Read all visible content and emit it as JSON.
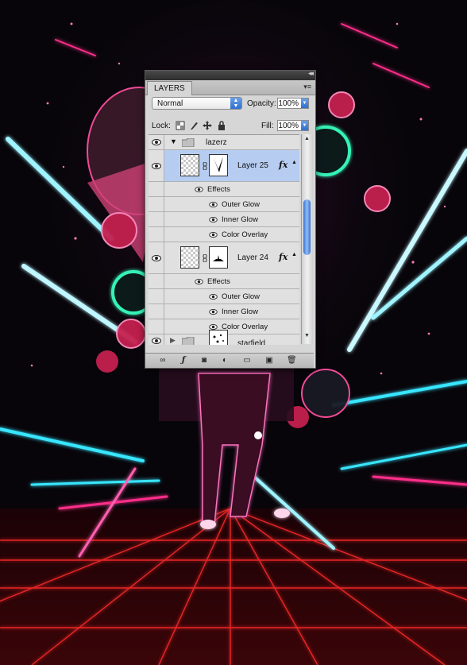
{
  "panel": {
    "tab_title": "LAYERS",
    "blend_mode": "Normal",
    "opacity_label": "Opacity:",
    "opacity_value": "100%",
    "lock_label": "Lock:",
    "fill_label": "Fill:",
    "fill_value": "100%"
  },
  "layers": {
    "group_name": "lazerz",
    "layer25": {
      "name": "Layer 25",
      "fx": "fx",
      "effects_label": "Effects",
      "effects": [
        "Outer Glow",
        "Inner Glow",
        "Color Overlay"
      ]
    },
    "layer24": {
      "name": "Layer 24",
      "fx": "fx",
      "effects_label": "Effects",
      "effects": [
        "Outer Glow",
        "Inner Glow",
        "Color Overlay"
      ]
    },
    "partial_name": "starfield"
  },
  "icons": {
    "eye": "eye-icon",
    "folder": "folder-icon",
    "chain": "link-icon",
    "lock_transparent": "lock-transparent-pixels-icon",
    "lock_image": "lock-image-pixels-icon",
    "lock_position": "lock-position-icon",
    "lock_all": "lock-all-icon",
    "bottom_bar": [
      "link-layers-icon",
      "fx-icon",
      "add-mask-icon",
      "adjustment-layer-icon",
      "new-group-icon",
      "new-layer-icon",
      "trash-icon"
    ]
  },
  "colors": {
    "selection": "#b6cdf1",
    "neon_pink": "#ff2d8a",
    "neon_cyan": "#39e6ff",
    "grid_red": "#ff2020"
  }
}
